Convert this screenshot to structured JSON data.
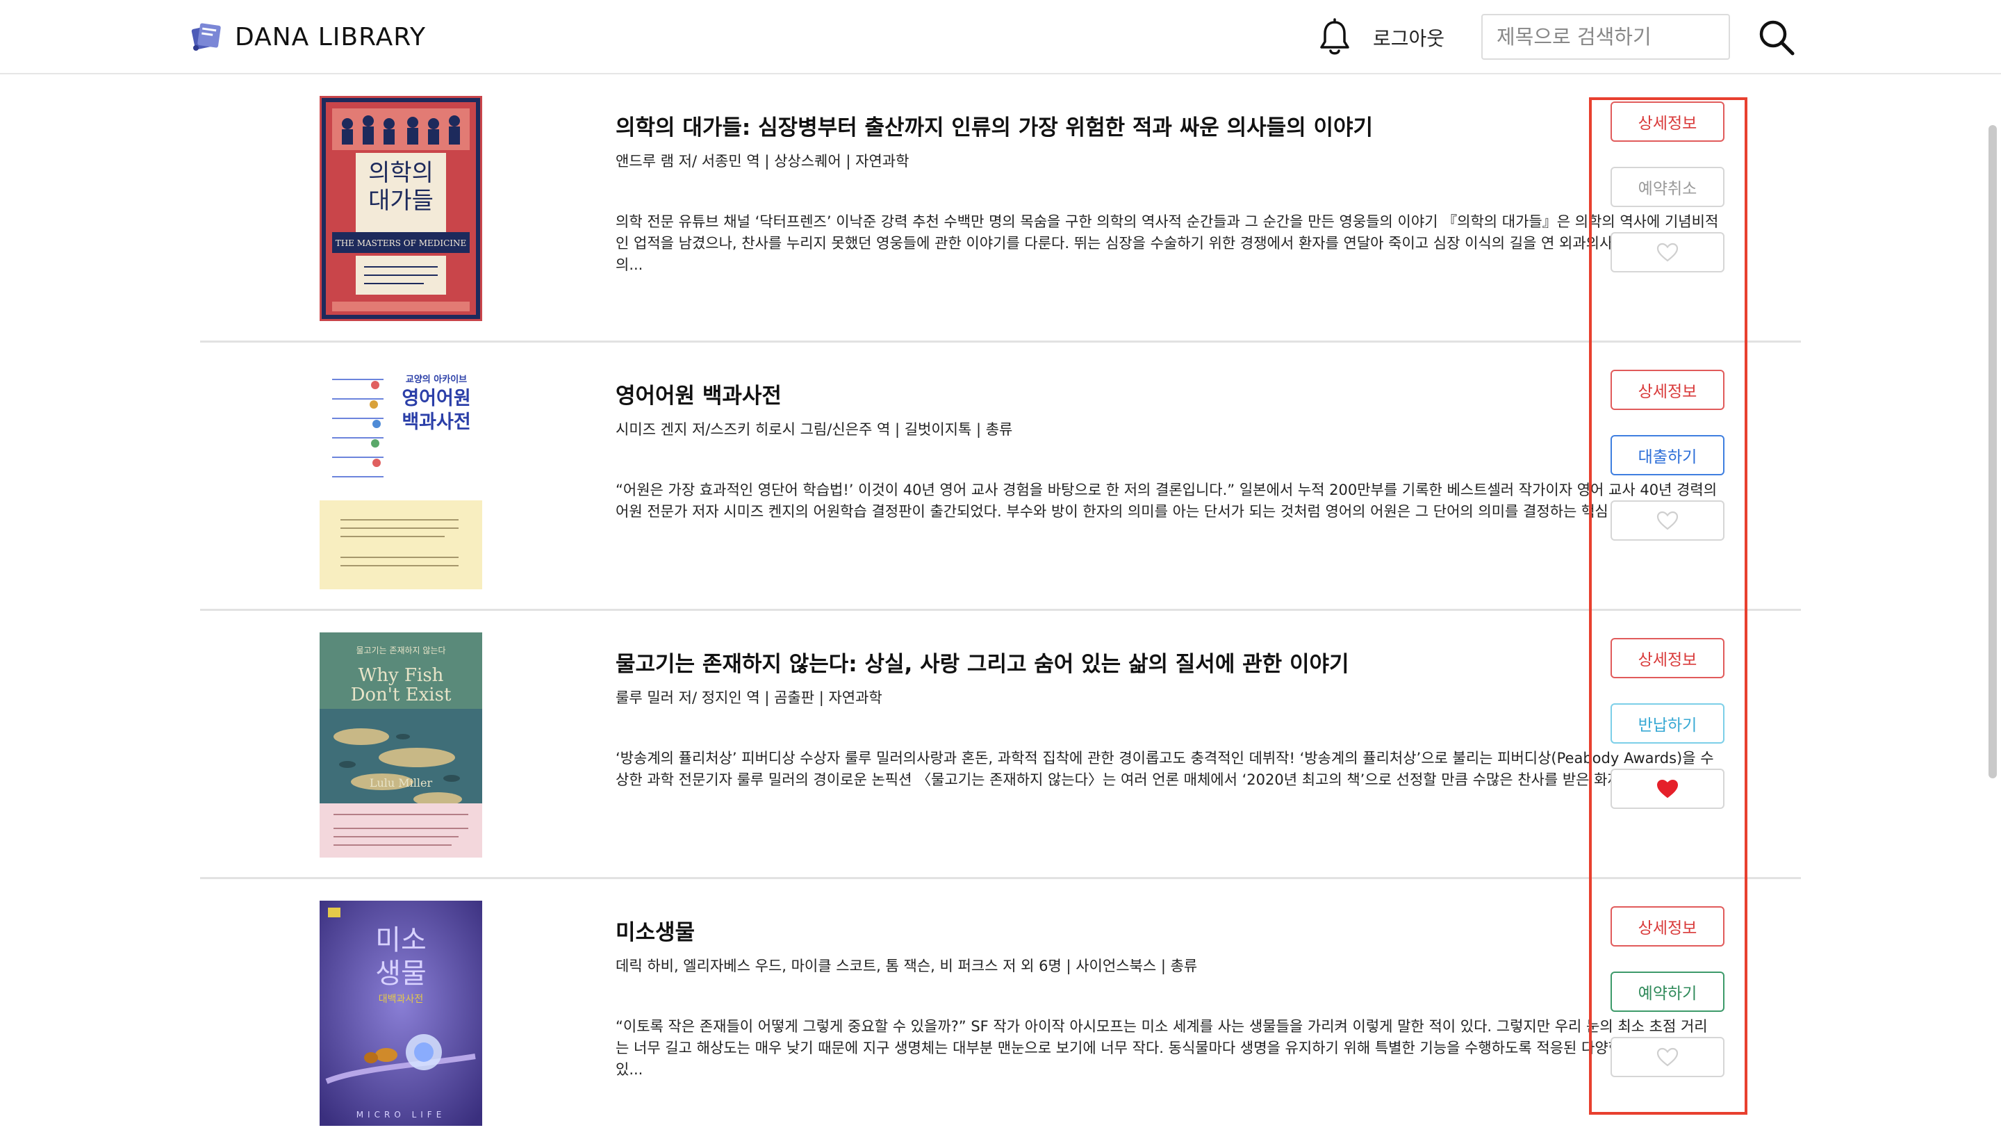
{
  "header": {
    "logo_text": "DANA LIBRARY",
    "logout_label": "로그아웃",
    "search_placeholder": "제목으로 검색하기",
    "icons": [
      "library-logo-icon",
      "bell-icon",
      "search-icon"
    ]
  },
  "books": [
    {
      "title": "의학의 대가들: 심장병부터 출산까지 인류의 가장 위험한 적과 싸운 의사들의 이야기",
      "meta": "앤드루 램 저/ 서종민 역 |  상상스퀘어    |    자연과학",
      "description": "의학 전문 유튜브 채널 ‘닥터프렌즈’ 이낙준 강력 추천 수백만 명의 목숨을 구한 의학의 역사적 순간들과 그 순간을 만든 영웅들의 이야기 『의학의 대가들』은 의학의 역사에 기념비적인 업적을 남겼으나, 찬사를 누리지 못했던 영웅들에 관한 이야기를 다룬다. 뛰는 심장을 수술하기 위한 경쟁에서 환자를 연달아 죽이고 심장 이식의 길을 연 외과의사들, 환자를 고의...",
      "cover": {
        "title_line1": "의학의",
        "title_line2": "대가들",
        "subtitle": "THE MASTERS OF MEDICINE",
        "bg": "#c9454a",
        "accent": "#1d2a5c"
      },
      "actions": {
        "detail": "상세정보",
        "secondary": "예약취소",
        "secondary_type": "cancel",
        "liked": false
      }
    },
    {
      "title": "영어어원 백과사전",
      "meta": "시미즈 겐지 저/스즈키 히로시 그림/신은주 역 |  길벗이지톡    |    총류",
      "description": "“어원은 가장 효과적인 영단어 학습법!’ 이것이 40년 영어 교사 경험을 바탕으로 한 저의 결론입니다.” 일본에서 누적 200만부를 기록한 베스트셀러 작가이자 영어 교사 40년 경력의 어원 전문가 저자 시미즈 켄지의 어원학습 결정판이 출간되었다. 부수와 방이 한자의 의미를 아는 단서가 되는 것처럼 영어의 어원은 그 단어의 의미를 결정하는 핵심 역할을 담당...",
      "cover": {
        "title_line0": "교양의 아카이브",
        "title_line1": "영어어원",
        "title_line2": "백과사전",
        "bg": "#ffffff",
        "accent": "#f8eec0"
      },
      "actions": {
        "detail": "상세정보",
        "secondary": "대출하기",
        "secondary_type": "borrow",
        "liked": false
      }
    },
    {
      "title": "물고기는 존재하지 않는다: 상실, 사랑 그리고 숨어 있는 삶의 질서에 관한 이야기",
      "meta": "룰루 밀러 저/ 정지인 역 |  곰출판    |    자연과학",
      "description": "‘방송계의 퓰리처상’ 피버디상 수상자 룰루 밀러의사랑과 혼돈, 과학적 집착에 관한 경이롭고도 충격적인 데뷔작! ‘방송계의 퓰리처상’으로 불리는 피버디상(Peabody Awards)을 수상한 과학 전문기자 룰루 밀러의 경이로운 논픽션 〈물고기는 존재하지 않는다〉는 여러 언론 매체에서 ‘2020년 최고의 책’으로 선정할 만큼 수많은 찬사를 받은 화제의 베스트...",
      "cover": {
        "title_line0": "물고기는 존재하지 않는다",
        "title_line1": "Why Fish",
        "title_line2": "Don't Exist",
        "author": "Lulu Miller",
        "bg": "#3f6e78",
        "accent": "#f3d7dc"
      },
      "actions": {
        "detail": "상세정보",
        "secondary": "반납하기",
        "secondary_type": "return",
        "liked": true
      }
    },
    {
      "title": "미소생물",
      "meta": "데릭 하비, 엘리자베스 우드, 마이클 스코트, 톰 잭슨, 비 퍼크스 저 외 6명 |  사이언스북스    |    총류",
      "description": "“이토록 작은 존재들이 어떻게 그렇게 중요할 수 있을까?” SF 작가 아이작 아시모프는 미소 세계를 사는 생물들을 가리켜 이렇게 말한 적이 있다. 그렇지만 우리 눈의 최소 초점 거리는 너무 길고 해상도는 매우 낮기 때문에 지구 생명체는 대부분 맨눈으로 보기에 너무 작다. 동식물마다 생명을 유지하기 위해 특별한 기능을 수행하도록 적응된 다양한 세포를 갖고 있...",
      "cover": {
        "title_line1": "미소",
        "title_line2": "생물",
        "subtitle": "대백과사전",
        "footer": "MICRO LIFE",
        "bg": "#4c3f93",
        "accent": "#8a7fd6"
      },
      "actions": {
        "detail": "상세정보",
        "secondary": "예약하기",
        "secondary_type": "reserve",
        "liked": false
      }
    }
  ]
}
